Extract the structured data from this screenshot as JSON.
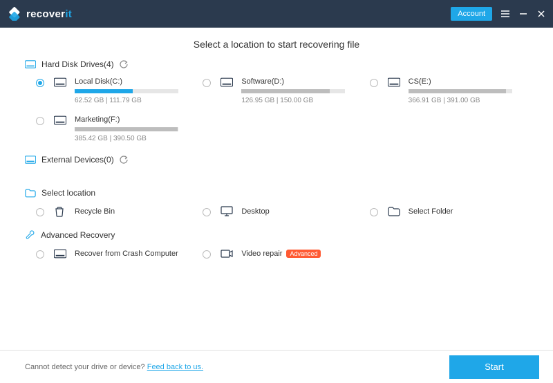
{
  "titlebar": {
    "brand_prefix": "recover",
    "brand_accent": "it",
    "account_label": "Account"
  },
  "page_title": "Select a location to start recovering file",
  "sections": {
    "hdd": {
      "label": "Hard Disk Drives(4)"
    },
    "external": {
      "label": "External Devices(0)"
    },
    "select_location": {
      "label": "Select location"
    },
    "advanced": {
      "label": "Advanced Recovery"
    }
  },
  "drives": [
    {
      "name": "Local Disk(C:)",
      "used": 62.52,
      "total": 111.79,
      "size_text": "62.52  GB | 111.79  GB",
      "selected": true
    },
    {
      "name": "Software(D:)",
      "used": 126.95,
      "total": 150.0,
      "size_text": "126.95  GB | 150.00  GB",
      "selected": false
    },
    {
      "name": "CS(E:)",
      "used": 366.91,
      "total": 391.0,
      "size_text": "366.91  GB | 391.00  GB",
      "selected": false
    },
    {
      "name": "Marketing(F:)",
      "used": 385.42,
      "total": 390.5,
      "size_text": "385.42  GB | 390.50  GB",
      "selected": false
    }
  ],
  "locations": {
    "recycle": "Recycle Bin",
    "desktop": "Desktop",
    "select_folder": "Select Folder"
  },
  "advanced_items": {
    "crash": "Recover from Crash Computer",
    "video": "Video repair",
    "video_badge": "Advanced"
  },
  "footer": {
    "text_prefix": "Cannot detect your drive or device? ",
    "link_text": "Feed back to us.",
    "start_label": "Start"
  }
}
